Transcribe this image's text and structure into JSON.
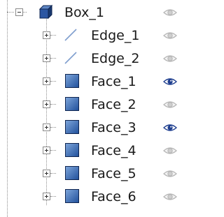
{
  "tree": {
    "root": {
      "label": "Box_1",
      "icon": "cube-icon",
      "expanded": true,
      "visible": false
    },
    "children": [
      {
        "label": "Edge_1",
        "icon": "edge-icon",
        "visible": false,
        "selected_eye": false
      },
      {
        "label": "Edge_2",
        "icon": "edge-icon",
        "visible": false,
        "selected_eye": false
      },
      {
        "label": "Face_1",
        "icon": "face-icon",
        "visible": true,
        "selected_eye": true
      },
      {
        "label": "Face_2",
        "icon": "face-icon",
        "visible": false,
        "selected_eye": false
      },
      {
        "label": "Face_3",
        "icon": "face-icon",
        "visible": true,
        "selected_eye": true
      },
      {
        "label": "Face_4",
        "icon": "face-icon",
        "visible": false,
        "selected_eye": false
      },
      {
        "label": "Face_5",
        "icon": "face-icon",
        "visible": false,
        "selected_eye": false
      },
      {
        "label": "Face_6",
        "icon": "face-icon",
        "visible": false,
        "selected_eye": false
      }
    ]
  },
  "colors": {
    "face_fill_light": "#7fa7dc",
    "face_fill_dark": "#1f4f9a",
    "cube_top": "#5e86c4",
    "cube_front": "#2c57a3",
    "cube_side": "#18386e",
    "eye_active": "#1f3f8f",
    "eye_inactive": "#b4b4b4",
    "edge_line": "#7f9ecf"
  }
}
